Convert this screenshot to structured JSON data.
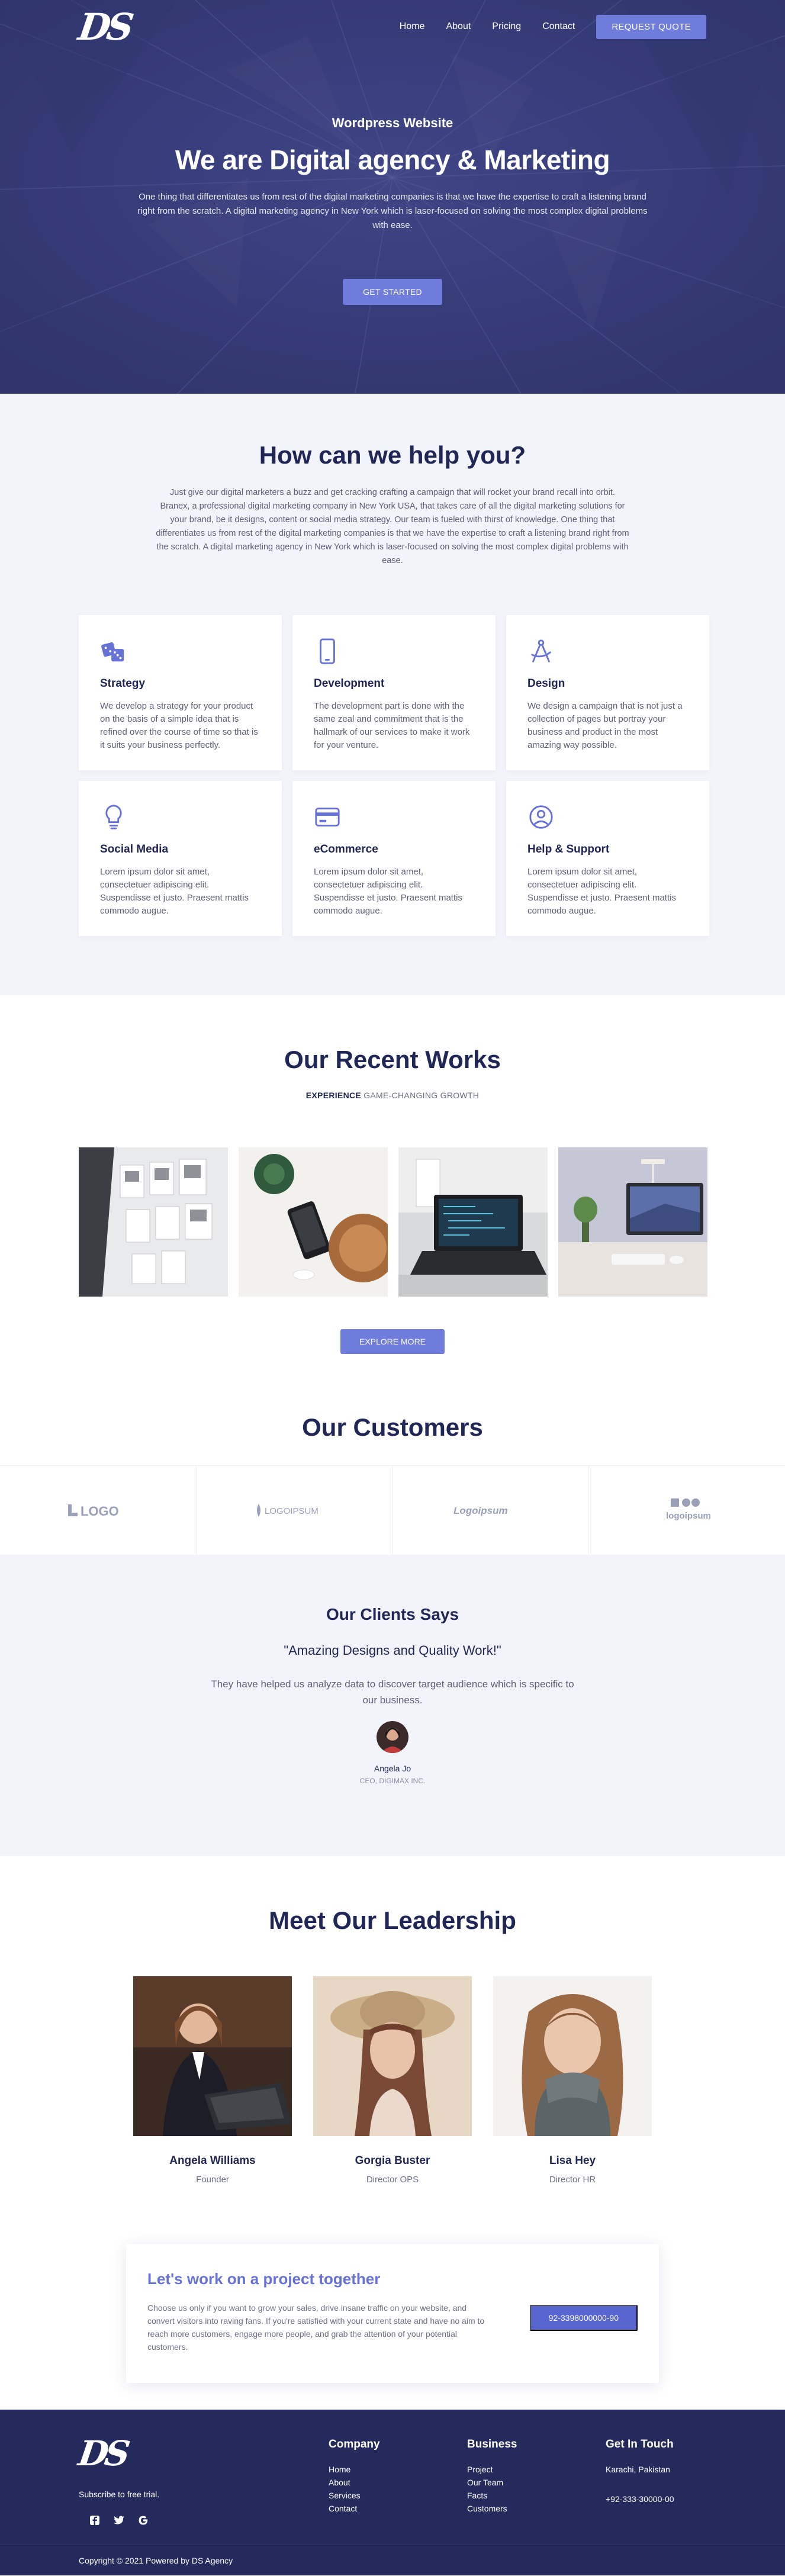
{
  "brand": {
    "logo_text": "DS",
    "accent": "#6f7cdc",
    "dark": "#202655"
  },
  "nav": {
    "links": [
      "Home",
      "About",
      "Pricing",
      "Contact"
    ],
    "cta": "REQUEST QUOTE"
  },
  "hero": {
    "kicker": "Wordpress Website",
    "title": "We are Digital agency & Marketing",
    "text": "One thing that differentiates us from rest of the digital marketing companies is that we have the expertise to craft a listening brand right from the scratch. A digital marketing agency in New York which is laser-focused on solving the most complex digital problems with ease.",
    "button": "GET STARTED"
  },
  "help": {
    "title": "How can we help you?",
    "intro": "Just give our digital marketers a buzz and get cracking crafting a campaign that will rocket your brand recall into orbit. Branex, a professional digital marketing company in New York USA, that takes care of all the digital marketing solutions for your brand, be it designs, content or social media strategy. Our team is fueled with thirst of knowledge. One thing that differentiates us from rest of the digital marketing companies is that we have the expertise to craft a listening brand right from the scratch. A digital marketing agency in New York which is laser-focused on solving the most complex digital problems with ease.",
    "services": [
      {
        "icon": "dice-icon",
        "title": "Strategy",
        "text": "We develop a strategy for your product on the basis of a simple idea that is refined over the course of time so that is it suits your business perfectly."
      },
      {
        "icon": "mobile-icon",
        "title": "Development",
        "text": "The development part is done with the same zeal and commitment that is the hallmark of our services to make it work for your venture."
      },
      {
        "icon": "compass-icon",
        "title": "Design",
        "text": "We design a campaign that is not just a collection of pages but portray your business and product in the most amazing way possible."
      },
      {
        "icon": "lightbulb-icon",
        "title": "Social Media",
        "text": "Lorem ipsum dolor sit amet, consectetuer adipiscing elit. Suspendisse et justo. Praesent mattis commodo augue."
      },
      {
        "icon": "credit-card-icon",
        "title": "eCommerce",
        "text": "Lorem ipsum dolor sit amet, consectetuer adipiscing elit. Suspendisse et justo. Praesent mattis commodo augue."
      },
      {
        "icon": "user-circle-icon",
        "title": "Help & Support",
        "text": "Lorem ipsum dolor sit amet, consectetuer adipiscing elit. Suspendisse et justo. Praesent mattis commodo augue."
      }
    ]
  },
  "works": {
    "title": "Our Recent Works",
    "sub_bold": "EXPERIENCE",
    "sub_rest": " GAME-CHANGING GROWTH",
    "button": "EXPLORE MORE"
  },
  "customers": {
    "title": "Our Customers",
    "logos": [
      "LOGO",
      "LOGOIPSUM",
      "Logoipsum",
      "logoipsum"
    ]
  },
  "testimonial": {
    "title": "Our Clients Says",
    "quote": "\"Amazing Designs and Quality Work!\"",
    "text": "They have helped us analyze data to discover target audience which is specific to our business.",
    "name": "Angela Jo",
    "role": "CEO, DIGIMAX INC."
  },
  "leaders": {
    "title": "Meet Our Leadership",
    "people": [
      {
        "name": "Angela Williams",
        "role": "Founder"
      },
      {
        "name": "Gorgia Buster",
        "role": "Director OPS"
      },
      {
        "name": "Lisa Hey",
        "role": "Director HR"
      }
    ]
  },
  "cta": {
    "title": "Let's work on a project together",
    "text": "Choose us only if you want to grow your sales, drive insane traffic on your website, and convert visitors into raving fans. If you're satisfied with your current state and have no aim to reach more customers, engage more people, and grab the attention of your potential customers.",
    "phone": "92-3398000000-90"
  },
  "footer": {
    "logo_text": "DS",
    "subscribe": "Subscribe to free trial.",
    "social": [
      "facebook-icon",
      "twitter-icon",
      "google-icon"
    ],
    "company": {
      "title": "Company",
      "links": [
        "Home",
        "About",
        "Services",
        "Contact"
      ]
    },
    "business": {
      "title": "Business",
      "links": [
        "Project",
        "Our Team",
        "Facts",
        "Customers"
      ]
    },
    "contact": {
      "title": "Get In Touch",
      "address": "Karachi, Pakistan",
      "phone": "+92-333-30000-00"
    },
    "copyright": "Copyright © 2021 Powered by DS Agency"
  }
}
